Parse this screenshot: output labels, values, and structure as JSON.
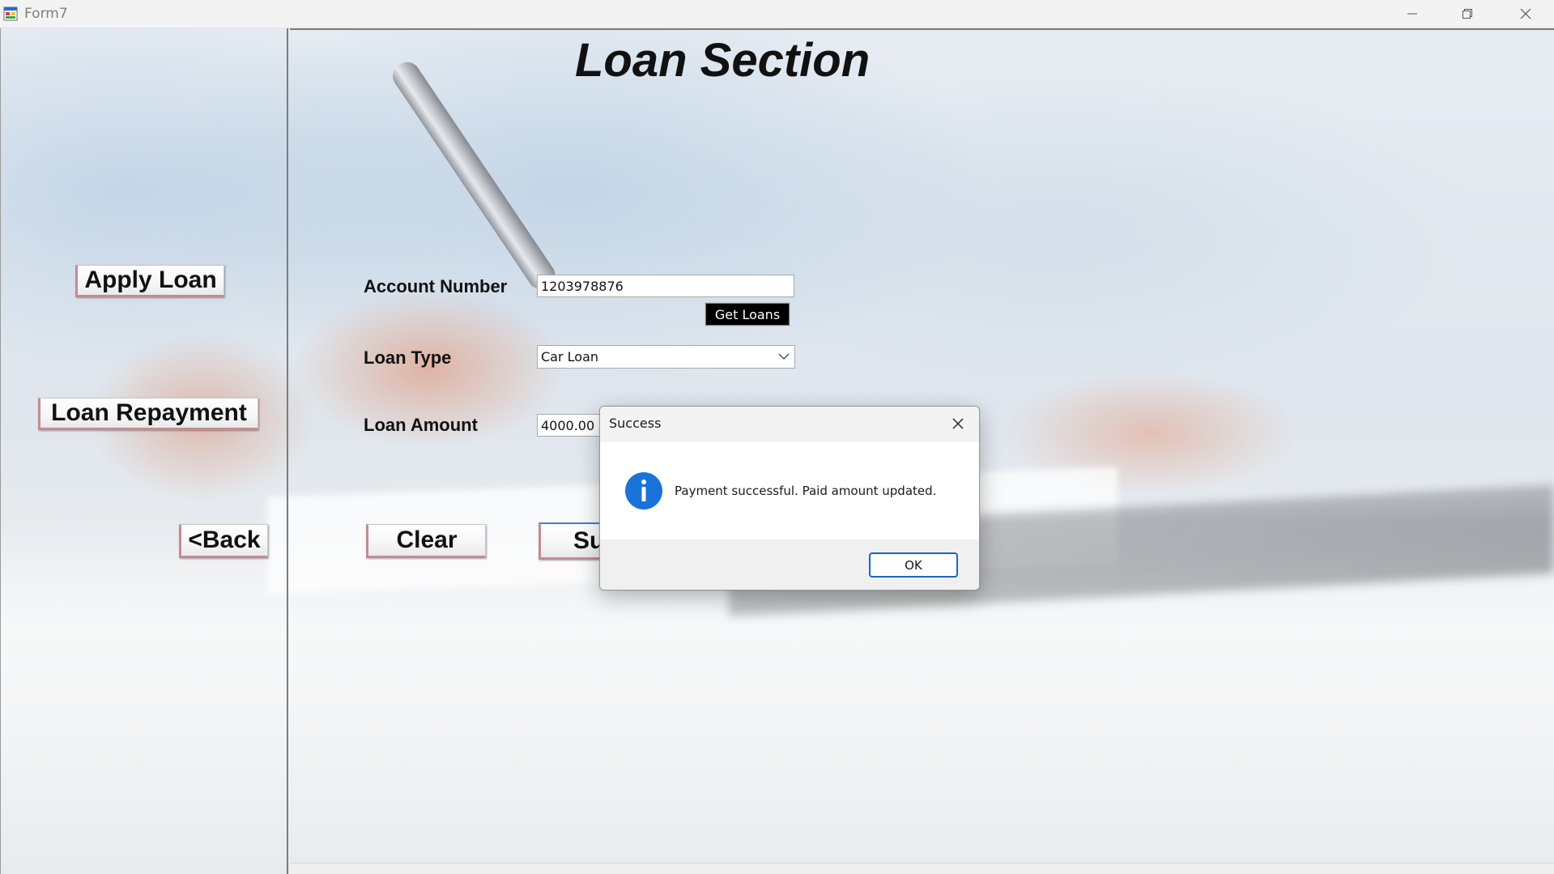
{
  "window": {
    "title": "Form7",
    "icon": "form-app-icon",
    "controls": {
      "minimize": "minimize-icon",
      "restore": "restore-icon",
      "close": "close-icon"
    }
  },
  "page": {
    "title": "Loan Section"
  },
  "sidebar": {
    "apply_loan_label": "Apply Loan",
    "loan_repayment_label": "Loan Repayment",
    "back_label": "<Back"
  },
  "form": {
    "account_number_label": "Account Number",
    "account_number_value": "1203978876",
    "get_loans_label": "Get Loans",
    "loan_type_label": "Loan Type",
    "loan_type_value": "Car Loan",
    "loan_amount_label": "Loan Amount",
    "loan_amount_value": "4000.00",
    "clear_label": "Clear",
    "submit_label_visible": "Su"
  },
  "dialog": {
    "title": "Success",
    "icon": "info-icon",
    "message": "Payment successful. Paid amount updated.",
    "ok_label": "OK"
  },
  "colors": {
    "dialog_accent": "#1a66c9",
    "info_icon": "#1a73d8",
    "button_accent": "#c58a93"
  }
}
